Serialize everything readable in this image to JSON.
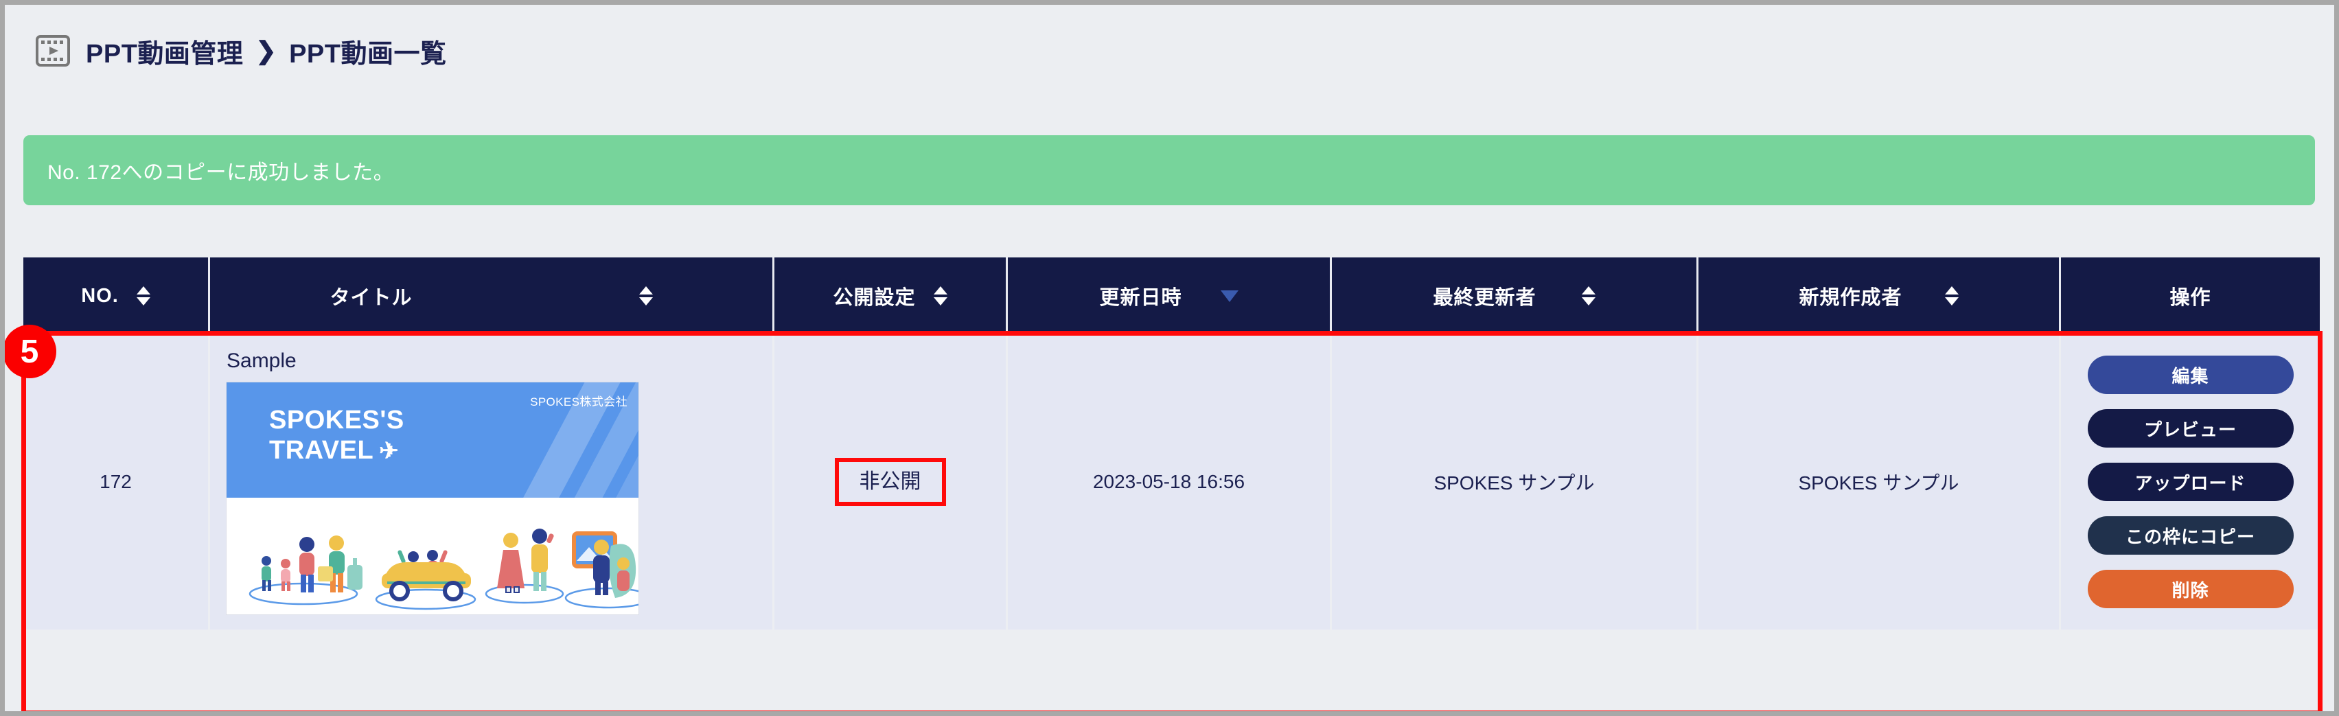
{
  "header": {
    "icon": "video-film-icon",
    "breadcrumb": [
      "PPT動画管理",
      "PPT動画一覧"
    ],
    "separator": "❯"
  },
  "alert": {
    "type": "success",
    "message": "No. 172へのコピーに成功しました。",
    "color": "#77d49b"
  },
  "table": {
    "columns": [
      {
        "label": "NO.",
        "sortable": true,
        "sort_state": "none"
      },
      {
        "label": "タイトル",
        "sortable": true,
        "sort_state": "none"
      },
      {
        "label": "公開設定",
        "sortable": true,
        "sort_state": "none"
      },
      {
        "label": "更新日時",
        "sortable": true,
        "sort_state": "desc"
      },
      {
        "label": "最終更新者",
        "sortable": true,
        "sort_state": "none"
      },
      {
        "label": "新規作成者",
        "sortable": true,
        "sort_state": "none"
      },
      {
        "label": "操作",
        "sortable": false,
        "sort_state": "none"
      }
    ],
    "header_bg": "#141a46",
    "rows": [
      {
        "no": "172",
        "title": "Sample",
        "thumbnail": {
          "headline_line1": "SPOKES'S",
          "headline_line2": "TRAVEL",
          "plane_icon": "✈",
          "company": "SPOKES株式会社",
          "banner_color": "#5896ea"
        },
        "publish_setting": "非公開",
        "updated_at": "2023-05-18 16:56",
        "last_editor": "SPOKES サンプル",
        "creator": "SPOKES サンプル",
        "actions": [
          {
            "label": "編集",
            "color": "#34499a"
          },
          {
            "label": "プレビュー",
            "color": "#141a46"
          },
          {
            "label": "アップロード",
            "color": "#141a46"
          },
          {
            "label": "この枠にコピー",
            "color": "#20314c"
          },
          {
            "label": "削除",
            "color": "#e0652f"
          }
        ]
      }
    ]
  },
  "annotations": {
    "step_number": "5",
    "highlight_color": "#ff0a0a"
  }
}
